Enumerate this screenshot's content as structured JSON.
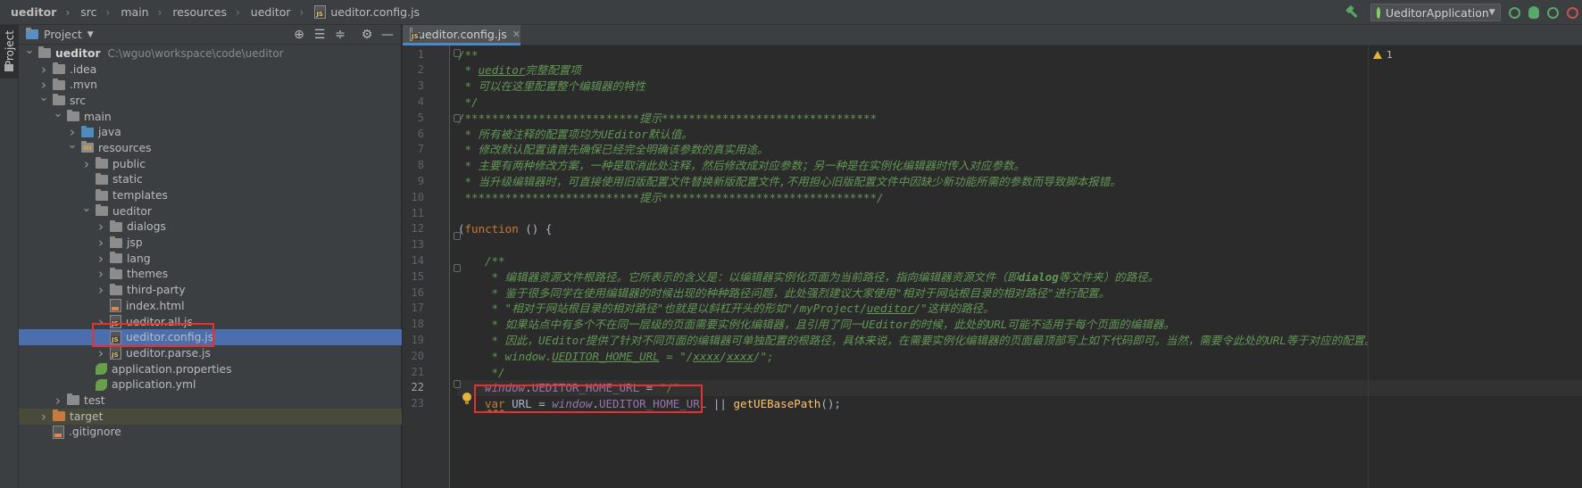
{
  "breadcrumb": [
    "ueditor",
    "src",
    "main",
    "resources",
    "ueditor",
    "ueditor.config.js"
  ],
  "run_config": {
    "label": "UeditorApplication"
  },
  "tool_strip": {
    "project_label": "Project"
  },
  "project_panel": {
    "title": "Project"
  },
  "tree": [
    {
      "label": "ueditor",
      "path": "C:\\wguo\\workspace\\code\\ueditor",
      "icon": "folder-icon",
      "arrow": "down",
      "depth": 0,
      "bold": true
    },
    {
      "label": ".idea",
      "icon": "folder-icon",
      "arrow": "right",
      "depth": 1
    },
    {
      "label": ".mvn",
      "icon": "folder-icon",
      "arrow": "right",
      "depth": 1
    },
    {
      "label": "src",
      "icon": "folder-icon",
      "arrow": "down",
      "depth": 1
    },
    {
      "label": "main",
      "icon": "folder-icon",
      "arrow": "down",
      "depth": 2
    },
    {
      "label": "java",
      "icon": "source-folder-icon",
      "arrow": "right",
      "depth": 3
    },
    {
      "label": "resources",
      "icon": "resources-folder-icon",
      "arrow": "down",
      "depth": 3
    },
    {
      "label": "public",
      "icon": "folder-icon",
      "arrow": "right",
      "depth": 4
    },
    {
      "label": "static",
      "icon": "folder-icon",
      "arrow": "none",
      "depth": 4
    },
    {
      "label": "templates",
      "icon": "folder-icon",
      "arrow": "none",
      "depth": 4
    },
    {
      "label": "ueditor",
      "icon": "folder-icon",
      "arrow": "down",
      "depth": 4
    },
    {
      "label": "dialogs",
      "icon": "folder-icon",
      "arrow": "right",
      "depth": 5
    },
    {
      "label": "jsp",
      "icon": "folder-icon",
      "arrow": "right",
      "depth": 5
    },
    {
      "label": "lang",
      "icon": "folder-icon",
      "arrow": "right",
      "depth": 5
    },
    {
      "label": "themes",
      "icon": "folder-icon",
      "arrow": "right",
      "depth": 5
    },
    {
      "label": "third-party",
      "icon": "folder-icon",
      "arrow": "right",
      "depth": 5
    },
    {
      "label": "index.html",
      "icon": "html-file-icon",
      "arrow": "none",
      "depth": 5
    },
    {
      "label": "ueditor.all.js",
      "icon": "js-file-icon",
      "arrow": "right",
      "depth": 5
    },
    {
      "label": "ueditor.config.js",
      "icon": "js-file-icon",
      "arrow": "none",
      "depth": 5,
      "selected": true
    },
    {
      "label": "ueditor.parse.js",
      "icon": "js-file-icon",
      "arrow": "right",
      "depth": 5
    },
    {
      "label": "application.properties",
      "icon": "spring-config-icon",
      "arrow": "none",
      "depth": 4
    },
    {
      "label": "application.yml",
      "icon": "spring-config-icon",
      "arrow": "none",
      "depth": 4
    },
    {
      "label": "test",
      "icon": "folder-icon",
      "arrow": "right",
      "depth": 2
    },
    {
      "label": "target",
      "icon": "excluded-folder-icon",
      "arrow": "right",
      "depth": 1,
      "highlight": true
    },
    {
      "label": ".gitignore",
      "icon": "file-icon",
      "arrow": "none",
      "depth": 1
    }
  ],
  "editor": {
    "tab_label": "ueditor.config.js",
    "warning_count": "1",
    "current_line": 22,
    "lines": [
      {
        "n": 1,
        "indent": 0,
        "segs": [
          {
            "t": "/**",
            "s": "c"
          }
        ]
      },
      {
        "n": 2,
        "indent": 1,
        "segs": [
          {
            "t": "* ",
            "s": "c"
          },
          {
            "t": "ueditor",
            "s": "cu"
          },
          {
            "t": "完整配置项",
            "s": "c"
          }
        ]
      },
      {
        "n": 3,
        "indent": 1,
        "segs": [
          {
            "t": "* 可以在这里配置整个编辑器的特性",
            "s": "c"
          }
        ]
      },
      {
        "n": 4,
        "indent": 1,
        "segs": [
          {
            "t": "*/",
            "s": "c"
          }
        ]
      },
      {
        "n": 5,
        "indent": 0,
        "segs": [
          {
            "t": "/**************************提示********************************",
            "s": "c"
          }
        ]
      },
      {
        "n": 6,
        "indent": 1,
        "segs": [
          {
            "t": "* 所有被注释的配置项均为UEditor默认值。",
            "s": "c"
          }
        ]
      },
      {
        "n": 7,
        "indent": 1,
        "segs": [
          {
            "t": "* 修改默认配置请首先确保已经完全明确该参数的真实用途。",
            "s": "c"
          }
        ]
      },
      {
        "n": 8,
        "indent": 1,
        "segs": [
          {
            "t": "* 主要有两种修改方案，一种是取消此处注释，然后修改成对应参数；另一种是在实例化编辑器时传入对应参数。",
            "s": "c"
          }
        ]
      },
      {
        "n": 9,
        "indent": 1,
        "segs": [
          {
            "t": "* 当升级编辑器时，可直接使用旧版配置文件替换新版配置文件,不用担心旧版配置文件中因缺少新功能所需的参数而导致脚本报错。",
            "s": "c"
          }
        ]
      },
      {
        "n": 10,
        "indent": 1,
        "segs": [
          {
            "t": "**************************提示********************************/",
            "s": "c"
          }
        ]
      },
      {
        "n": 11,
        "indent": 0,
        "segs": []
      },
      {
        "n": 12,
        "indent": 0,
        "segs": [
          {
            "t": "(",
            "s": "id"
          },
          {
            "t": "function",
            "s": "kw"
          },
          {
            "t": " () {",
            "s": "id"
          }
        ]
      },
      {
        "n": 13,
        "indent": 0,
        "segs": []
      },
      {
        "n": 14,
        "indent": 4,
        "segs": [
          {
            "t": "/**",
            "s": "c"
          }
        ]
      },
      {
        "n": 15,
        "indent": 5,
        "segs": [
          {
            "t": "* 编辑器资源文件根路径。它所表示的含义是：以编辑器实例化页面为当前路径，指向编辑器资源文件（即",
            "s": "c"
          },
          {
            "t": "dialog",
            "s": "cb"
          },
          {
            "t": "等文件夹）的路径。",
            "s": "c"
          }
        ]
      },
      {
        "n": 16,
        "indent": 5,
        "segs": [
          {
            "t": "* 鉴于很多同学在使用编辑器的时候出现的种种路径问题，此处强烈建议大家使用\"相对于网站根目录的相对路径\"进行配置。",
            "s": "c"
          }
        ]
      },
      {
        "n": 17,
        "indent": 5,
        "segs": [
          {
            "t": "* \"相对于网站根目录的相对路径\"也就是以斜杠开头的形如\"/myProject/",
            "s": "c"
          },
          {
            "t": "ueditor",
            "s": "cu"
          },
          {
            "t": "/\"这样的路径。",
            "s": "c"
          }
        ]
      },
      {
        "n": 18,
        "indent": 5,
        "segs": [
          {
            "t": "* 如果站点中有多个不在同一层级的页面需要实例化编辑器，且引用了同一UEditor的时候，此处的URL可能不适用于每个页面的编辑器。",
            "s": "c"
          }
        ]
      },
      {
        "n": 19,
        "indent": 5,
        "segs": [
          {
            "t": "* 因此，UEditor提供了针对不同页面的编辑器可单独配置的根路径，具体来说，在需要实例化编辑器的页面最顶部写上如下代码即可。当然，需要令此处的URL等于对应的配置。",
            "s": "c"
          }
        ]
      },
      {
        "n": 20,
        "indent": 5,
        "segs": [
          {
            "t": "* window.",
            "s": "c"
          },
          {
            "t": "UEDITOR_HOME_URL",
            "s": "cu"
          },
          {
            "t": " = \"/",
            "s": "c"
          },
          {
            "t": "xxxx",
            "s": "cu"
          },
          {
            "t": "/",
            "s": "c"
          },
          {
            "t": "xxxx",
            "s": "cu"
          },
          {
            "t": "/\";",
            "s": "c"
          }
        ]
      },
      {
        "n": 21,
        "indent": 5,
        "segs": [
          {
            "t": "*/",
            "s": "c"
          }
        ]
      },
      {
        "n": 22,
        "indent": 4,
        "segs": [
          {
            "t": "window",
            "s": "glob"
          },
          {
            "t": ".",
            "s": "id"
          },
          {
            "t": "UEDITOR_HOME_URL",
            "s": "prop"
          },
          {
            "t": " = ",
            "s": "id"
          },
          {
            "t": "\"/\"",
            "s": "str"
          }
        ]
      },
      {
        "n": 23,
        "indent": 4,
        "segs": [
          {
            "t": "var",
            "s": "kw warn-ul"
          },
          {
            "t": " URL = ",
            "s": "id"
          },
          {
            "t": "window",
            "s": "glob"
          },
          {
            "t": ".",
            "s": "id"
          },
          {
            "t": "UEDITOR_HOME_URL",
            "s": "prop"
          },
          {
            "t": " || ",
            "s": "id"
          },
          {
            "t": "getUEBasePath",
            "s": "fn"
          },
          {
            "t": "();",
            "s": "id"
          }
        ]
      }
    ]
  },
  "colors": {
    "selection": "#4b6eaf",
    "accent": "#4a88c7",
    "annotation": "#e8302e"
  }
}
